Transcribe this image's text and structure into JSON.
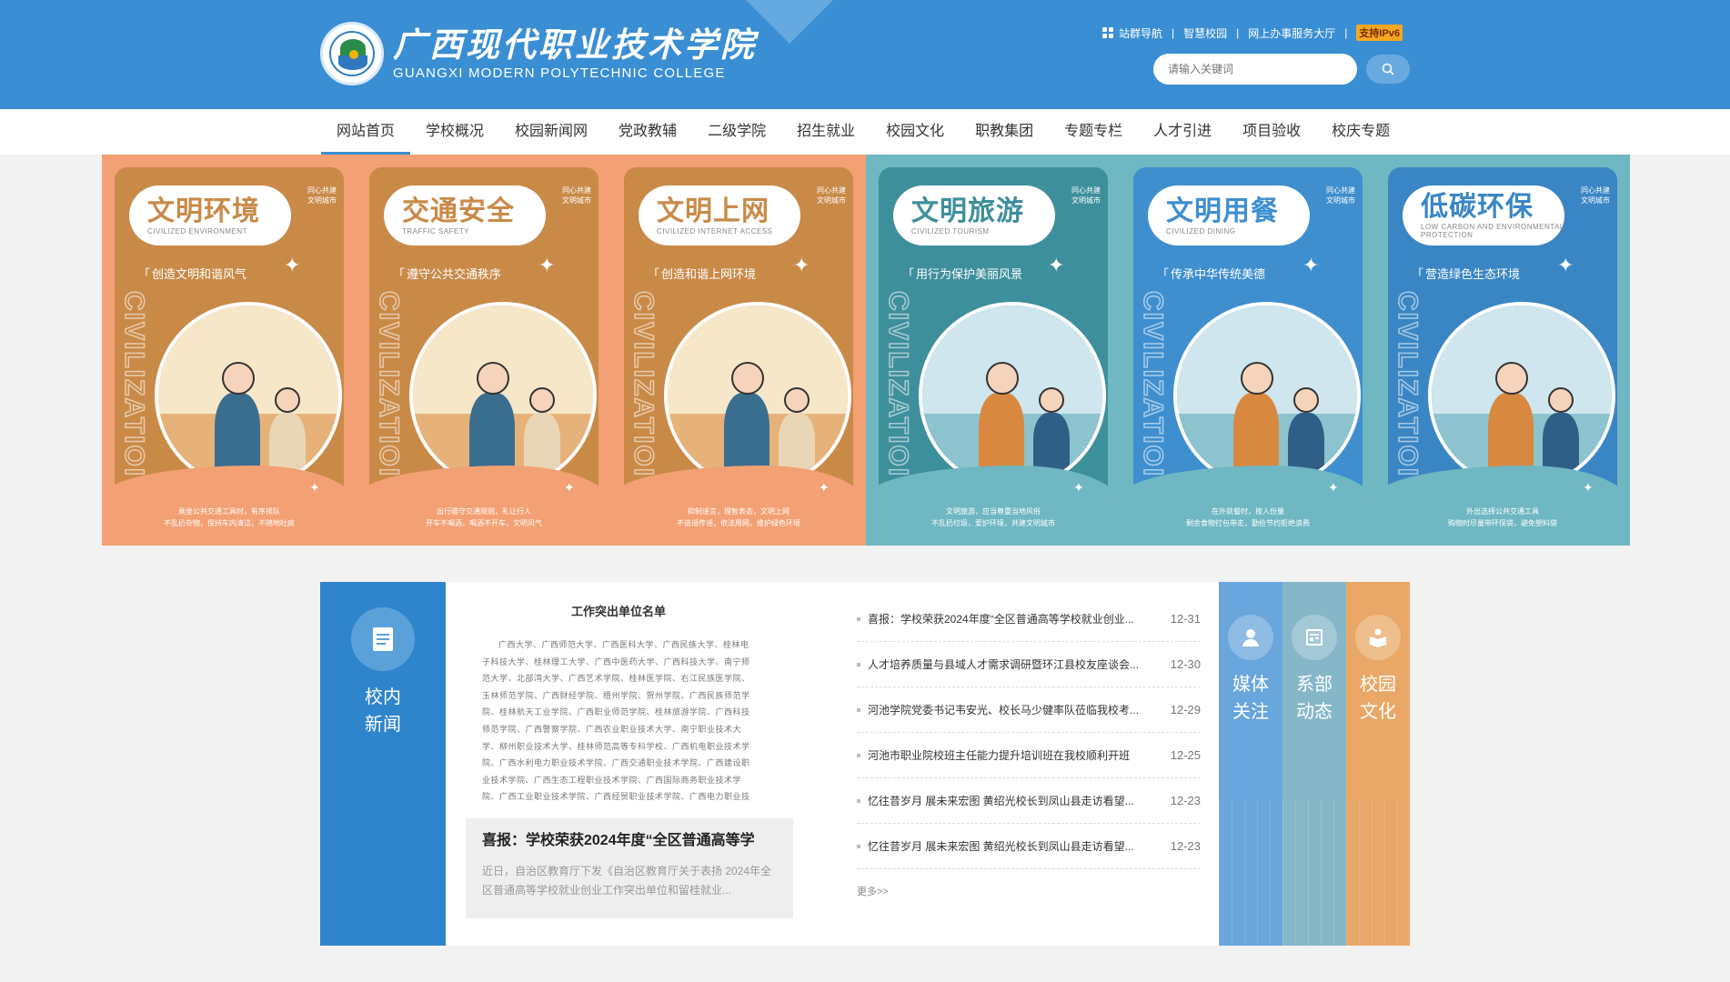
{
  "brand": {
    "name_cn": "广西现代职业技术学院",
    "name_en": "GUANGXI MODERN POLYTECHNIC COLLEGE"
  },
  "toplinks": {
    "site_nav": "站群导航",
    "smart_campus": "智慧校园",
    "online_service": "网上办事服务大厅",
    "ipv6": "支持IPv6"
  },
  "search": {
    "placeholder": "请输入关键词"
  },
  "nav": [
    "网站首页",
    "学校概况",
    "校园新闻网",
    "党政教辅",
    "二级学院",
    "招生就业",
    "校园文化",
    "职教集团",
    "专题专栏",
    "人才引进",
    "项目验收",
    "校庆专题"
  ],
  "banner": {
    "corner": "同心共建\n文明城市",
    "vertical": "CIVILIZATIOI",
    "posters": [
      {
        "title": "文明环境",
        "subtitle": "CIVILIZED ENVIRONMENT",
        "slogan": "创造文明和谐风气",
        "foot": "乘坐公共交通工具时，有序排队\n不乱扔杂物，保持车内清洁，不随地吐痰",
        "bg": "#f2a074",
        "frame": "#c98a48",
        "accent": "#c98a48"
      },
      {
        "title": "交通安全",
        "subtitle": "TRAFFIC SAFETY",
        "slogan": "遵守公共交通秩序",
        "foot": "出行遵守交通规则，礼让行人\n开车不喝酒，喝酒不开车，文明风气",
        "bg": "#f2a074",
        "frame": "#c98a48",
        "accent": "#c98a48"
      },
      {
        "title": "文明上网",
        "subtitle": "CIVILIZED INTERNET ACCESS",
        "slogan": "创造和谐上网环境",
        "foot": "抑制谣言，理智表态，文明上网\n不造谣传谣，依法用网，维护绿色环境",
        "bg": "#f2a074",
        "frame": "#c98a48",
        "accent": "#c98a48"
      },
      {
        "title": "文明旅游",
        "subtitle": "CIVILIZED TOURISM",
        "slogan": "用行为保护美丽风景",
        "foot": "文明旅游，应当尊重当地风俗\n不乱扔垃圾，爱护环境，共建文明城市",
        "bg": "#6fb7c2",
        "frame": "#3e8f9c",
        "accent": "#3e8f9c"
      },
      {
        "title": "文明用餐",
        "subtitle": "CIVILIZED DINING",
        "slogan": "传承中华传统美德",
        "foot": "在外就餐时，按人份量\n剩余食物打包带走，勤俭节约拒绝浪费",
        "bg": "#6fb7c2",
        "frame": "#3f8fcf",
        "accent": "#3f8fcf"
      },
      {
        "title": "低碳环保",
        "subtitle": "LOW CARBON AND ENVIRONMENTAL PROTECTION",
        "slogan": "营造绿色生态环境",
        "foot": "外出选择公共交通工具\n购物时尽量带环保袋，避免塑料袋",
        "bg": "#6fb7c2",
        "frame": "#3a86c4",
        "accent": "#3a86c4"
      }
    ]
  },
  "tiles": {
    "news": "校内\n新闻",
    "media": "媒体\n关注",
    "dept": "系部\n动态",
    "culture": "校园\n文化"
  },
  "colors": {
    "header_blue": "#3a8ed3",
    "news_tile": "#2f85cc",
    "media_tile": "#68a6dc",
    "dept_tile": "#86b7c9",
    "culture_tile": "#e9a867"
  },
  "feature": {
    "doc_title": "工作突出单位名单",
    "doc_body": "广西大学、广西师范大学、广西医科大学、广西民族大学、桂林电子科技大学、桂林理工大学、广西中医药大学、广西科技大学、南宁师范大学、北部湾大学、广西艺术学院、桂林医学院、右江民族医学院、玉林师范学院、广西财经学院、梧州学院、贺州学院、广西民族师范学院、桂林航天工业学院、广西职业师范学院、桂林旅游学院、广西科技师范学院、广西警察学院、广西农业职业技术大学、南宁职业技术大学、柳州职业技术大学、桂林师范高等专科学校、广西机电职业技术学院、广西水利电力职业技术学院、广西交通职业技术学院、广西建设职业技术学院、广西生态工程职业技术学院、广西国际商务职业技术学院、广西工业职业技术学院、广西经贸职业技术学院、广西电力职业技术",
    "caption_title": "喜报：学校荣获2024年度“全区普通高等学",
    "caption_desc": "近日，自治区教育厅下发《自治区教育厅关于表扬 2024年全区普通高等学校就业创业工作突出单位和留桂就业..."
  },
  "news": [
    {
      "title": "喜报：学校荣获2024年度“全区普通高等学校就业创业...",
      "date": "12-31"
    },
    {
      "title": "人才培养质量与县域人才需求调研暨环江县校友座谈会...",
      "date": "12-30"
    },
    {
      "title": "河池学院党委书记韦安光、校长马少健率队莅临我校考...",
      "date": "12-29"
    },
    {
      "title": "河池市职业院校班主任能力提升培训班在我校顺利开班",
      "date": "12-25"
    },
    {
      "title": "忆往昔岁月 展未来宏图 黄绍光校长到凤山县走访看望...",
      "date": "12-23"
    },
    {
      "title": "忆往昔岁月 展未来宏图 黄绍光校长到凤山县走访看望...",
      "date": "12-23"
    }
  ],
  "more": "更多>>"
}
